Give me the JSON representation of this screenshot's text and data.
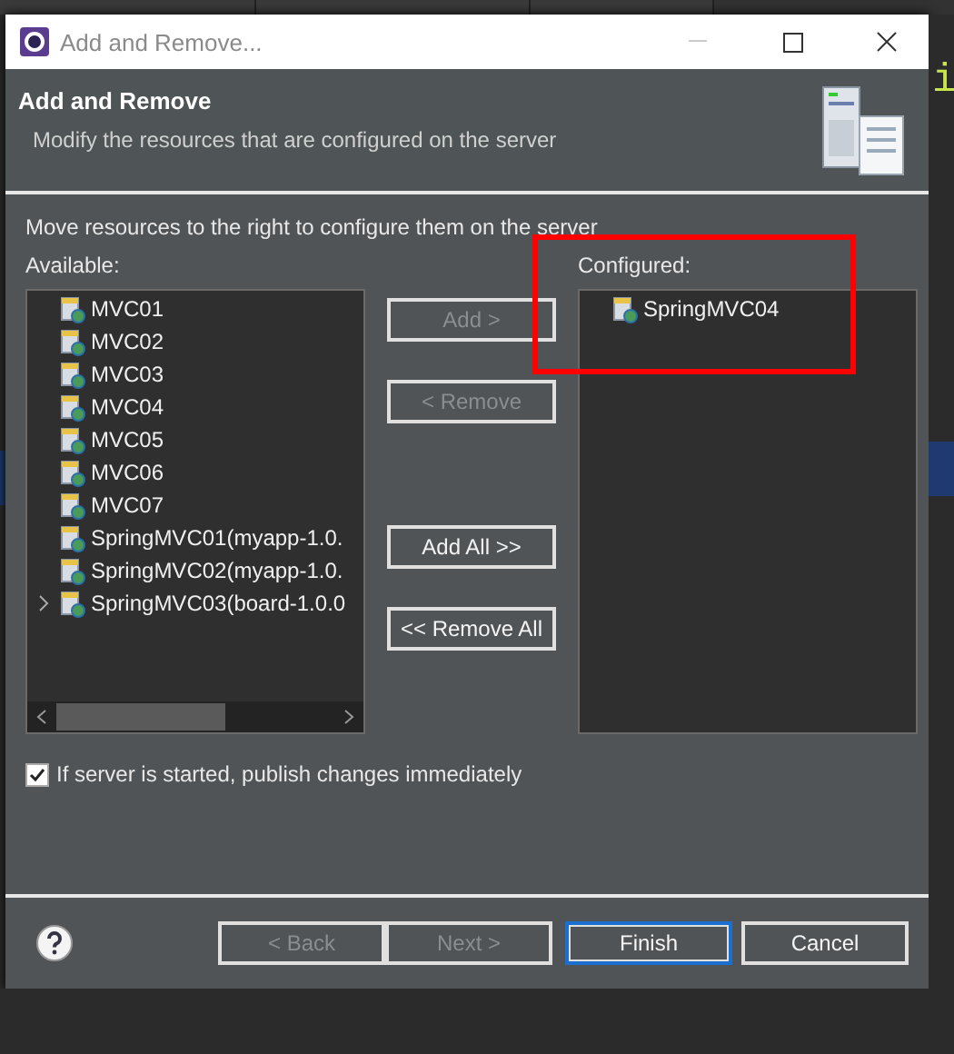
{
  "editor": {
    "visible_char": "i"
  },
  "window": {
    "title": "Add and Remove..."
  },
  "header": {
    "title": "Add and Remove",
    "description": "Modify the resources that are configured on the server"
  },
  "instruction": "Move resources to the right to configure them on the server",
  "available": {
    "label": "Available:",
    "items": [
      {
        "name": "MVC01",
        "expandable": false
      },
      {
        "name": "MVC02",
        "expandable": false
      },
      {
        "name": "MVC03",
        "expandable": false
      },
      {
        "name": "MVC04",
        "expandable": false
      },
      {
        "name": "MVC05",
        "expandable": false
      },
      {
        "name": "MVC06",
        "expandable": false
      },
      {
        "name": "MVC07",
        "expandable": false
      },
      {
        "name": "SpringMVC01(myapp-1.0.",
        "expandable": false
      },
      {
        "name": "SpringMVC02(myapp-1.0.",
        "expandable": false
      },
      {
        "name": "SpringMVC03(board-1.0.0",
        "expandable": true
      }
    ]
  },
  "move_buttons": [
    {
      "label": "Add >",
      "disabled": true
    },
    {
      "label": "< Remove",
      "disabled": true
    },
    {
      "label": "Add All >>",
      "disabled": false
    },
    {
      "label": "<< Remove All",
      "disabled": false
    }
  ],
  "configured": {
    "label": "Configured:",
    "items": [
      {
        "name": "SpringMVC04",
        "expandable": false
      }
    ]
  },
  "publish_checkbox": {
    "label": "If server is started, publish changes immediately",
    "checked": true
  },
  "footer_buttons": [
    {
      "label": "< Back",
      "disabled": true,
      "default": false
    },
    {
      "label": "Next >",
      "disabled": true,
      "default": false
    },
    {
      "label": "Finish",
      "disabled": false,
      "default": true
    },
    {
      "label": "Cancel",
      "disabled": false,
      "default": false
    }
  ]
}
